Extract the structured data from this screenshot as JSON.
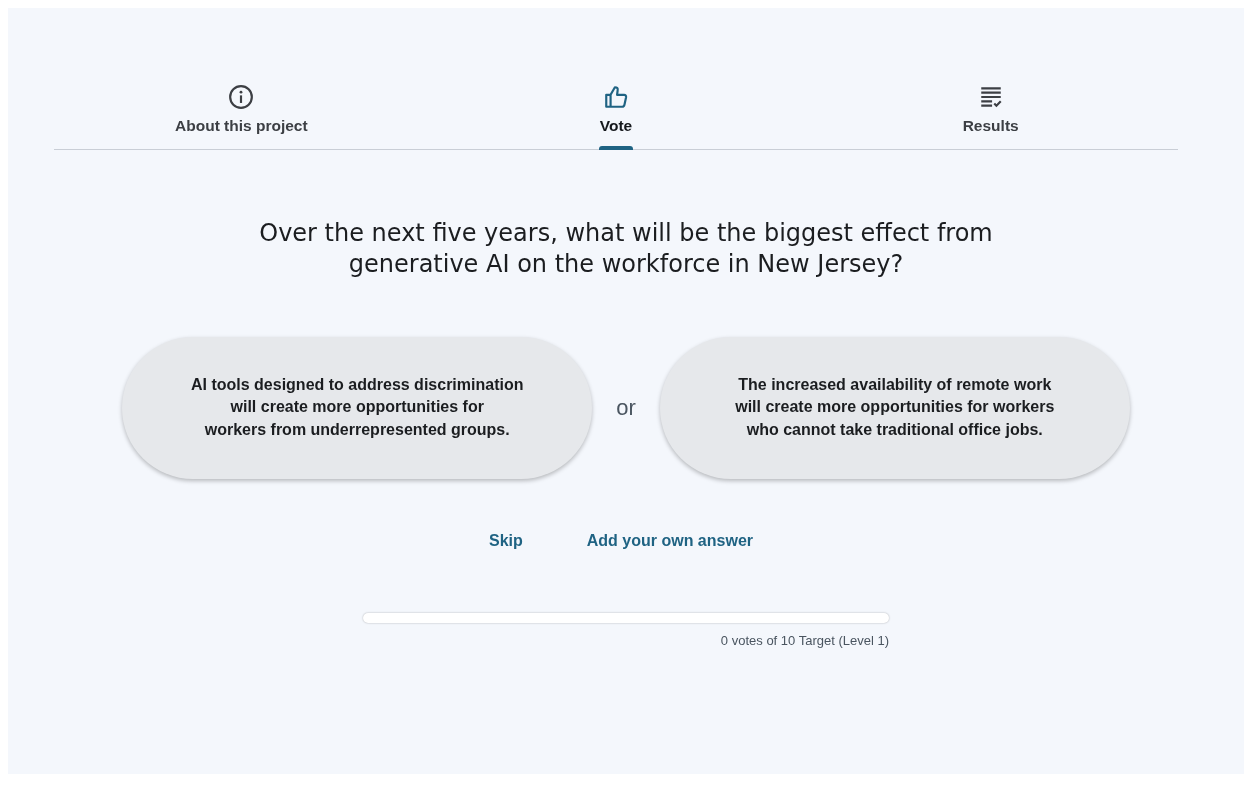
{
  "tabs": [
    {
      "label": "About this project",
      "kind": "info",
      "selected": false
    },
    {
      "label": "Vote",
      "kind": "thumb",
      "selected": true
    },
    {
      "label": "Results",
      "kind": "list",
      "selected": false
    }
  ],
  "question": "Over the next five years, what will be the biggest effect from generative AI on the workforce in New Jersey?",
  "options": [
    {
      "text": "AI tools designed to address discrimination\nwill create more opportunities for\nworkers from underrepresented groups."
    },
    {
      "text": "The increased availability of remote work\nwill create more opportunities for workers\nwho cannot take traditional office jobs."
    }
  ],
  "separator": "or",
  "links": [
    "Skip",
    "Add your own answer"
  ],
  "progress": {
    "level": 0,
    "caption": "0 votes of 10 Target (Level 1)"
  }
}
